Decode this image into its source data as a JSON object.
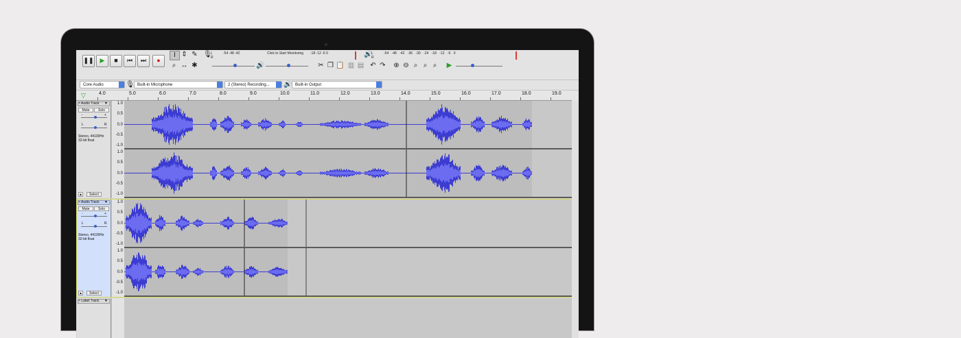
{
  "toolbar": {
    "transport": {
      "pause": "pause-icon",
      "play": "play-icon",
      "stop": "stop-icon",
      "skip_start": "skip-start-icon",
      "skip_end": "skip-end-icon",
      "record": "record-icon"
    },
    "record_meter_label": "Click to Start Monitoring",
    "meter_scale_left": "-54   -48   -42",
    "meter_scale_mid": "-18   -12   -6   0",
    "meter_scale_right": "-54   -48   -42   -36   -30   -24   -18   -12   -6   0",
    "lr_text": "L\nR"
  },
  "device_bar": {
    "host": "Core Audio",
    "input": "Built-in Microphone",
    "channels": "2 (Stereo) Recording...",
    "output": "Built-in Output"
  },
  "ruler": {
    "ticks": [
      "4.0",
      "5.0",
      "6.0",
      "7.0",
      "8.0",
      "9.0",
      "10.0",
      "11.0",
      "12.0",
      "13.0",
      "14.0",
      "15.0",
      "16.0",
      "17.0",
      "18.0",
      "19.0"
    ]
  },
  "tracks": [
    {
      "name": "Audio Track",
      "mute": "Mute",
      "solo": "Solo",
      "info": "Stereo, 44100Hz\n32-bit float",
      "select": "Select",
      "gain_minus": "-",
      "gain_plus": "+",
      "pan_l": "L",
      "pan_r": "R"
    },
    {
      "name": "Audio Track",
      "mute": "Mute",
      "solo": "Solo",
      "info": "Stereo, 44100Hz\n32-bit float",
      "select": "Select",
      "gain_minus": "-",
      "gain_plus": "+",
      "pan_l": "L",
      "pan_r": "R"
    },
    {
      "name": "Label Track"
    }
  ],
  "vruler_labels": [
    "1.0",
    "0.5",
    "0.0",
    "-0.5",
    "-1.0"
  ],
  "colors": {
    "wave": "#3c3cd2",
    "wave_rms": "#6c6cf0",
    "selected_border": "#d8d85a"
  }
}
